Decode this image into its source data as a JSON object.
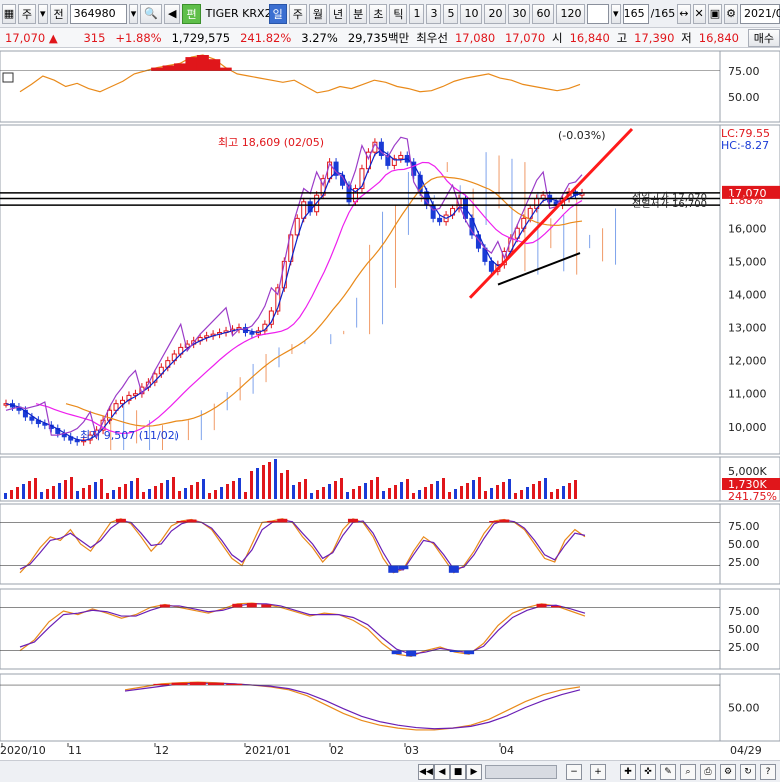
{
  "toolbar": {
    "menu_label": "주",
    "search_label": "전",
    "code": "364980",
    "name_tag": "편",
    "stock_name": "TIGER KRX2",
    "periods": [
      "일",
      "주",
      "월",
      "년",
      "분",
      "초",
      "틱"
    ],
    "selected_period": "일",
    "intervals": [
      "1",
      "3",
      "5",
      "10",
      "20",
      "30",
      "60",
      "120"
    ],
    "count_value": "165",
    "count_total": "/165",
    "date_value": "2021/0"
  },
  "quote": {
    "price": "17,070",
    "change": "315",
    "change_pct": "+1.88%",
    "volume": "1,729,575",
    "volume_ratio": "241.82%",
    "turnover": "3.27%",
    "amount": "29,735백만",
    "best_label": "최우선",
    "ask": "17,080",
    "bid": "17,070",
    "open_label": "시",
    "open": "16,840",
    "high_label": "고",
    "high": "17,390",
    "low_label": "저",
    "low": "16,840",
    "order_button": "매수"
  },
  "colors": {
    "up": "#e0161b",
    "down": "#1a3bd6",
    "ma5": "#0b22c9",
    "ma20": "#ee1fee",
    "kumo_up": "#f09a67",
    "kumo_down": "#7ea3ec"
  },
  "chart_data": [
    {
      "type": "line",
      "title": "",
      "y_ticks": [
        "75.00",
        "50.00"
      ],
      "ylim": [
        30,
        90
      ],
      "series": [
        {
          "values": [
            55,
            62,
            70,
            66,
            60,
            63,
            58,
            55,
            60,
            65,
            72,
            75,
            78,
            80,
            82,
            88,
            90,
            86,
            78,
            72,
            70,
            68,
            66,
            64,
            66,
            60,
            54,
            56,
            60,
            58,
            62,
            66,
            64,
            60,
            58,
            55,
            56,
            60,
            65,
            68,
            70,
            72,
            68,
            66,
            62,
            60,
            58,
            56,
            58,
            62
          ]
        }
      ]
    },
    {
      "type": "candlestick",
      "title": "",
      "annotations": {
        "high_label": "최고 18,609 (02/05)",
        "low_label": "최저 9,507 (11/02)",
        "change_label": "(-0.03%)",
        "lc": "LC:79.55",
        "hc": "HC:-8.27",
        "prev_high": "전일고가 17,070",
        "prev_low": "전일저가 16,700",
        "pct": "1.88%",
        "last": "17,070"
      },
      "y_ticks": [
        "16,000",
        "15,000",
        "14,000",
        "13,000",
        "12,000",
        "11,000",
        "10,000"
      ],
      "ylim": [
        9300,
        19000
      ],
      "x_ticks": [
        "2020/10",
        "11",
        "12",
        "2021/01",
        "02",
        "03",
        "04",
        "04/29"
      ],
      "close": [
        10700,
        10600,
        10500,
        10300,
        10200,
        10100,
        10050,
        9950,
        9800,
        9700,
        9600,
        9550,
        9600,
        9750,
        9900,
        10200,
        10500,
        10700,
        10800,
        10950,
        11000,
        11200,
        11350,
        11600,
        11800,
        12000,
        12200,
        12400,
        12500,
        12600,
        12700,
        12750,
        12800,
        12850,
        12900,
        12950,
        13000,
        12850,
        12800,
        12900,
        13100,
        13500,
        14200,
        15000,
        15800,
        16300,
        16800,
        16500,
        17000,
        17500,
        18000,
        17600,
        17300,
        16800,
        17200,
        17800,
        18300,
        18600,
        18200,
        17900,
        18100,
        18200,
        18000,
        17600,
        17100,
        16700,
        16300,
        16200,
        16400,
        16600,
        16900,
        16300,
        15800,
        15400,
        15000,
        14700,
        14900,
        15300,
        15700,
        16000,
        16300,
        16600,
        16900,
        17000,
        16800,
        16700,
        16900,
        17100,
        17000,
        17070
      ]
    },
    {
      "type": "bar",
      "title": "",
      "y_ticks": [
        "5,000K",
        "1,730K"
      ],
      "pct_label": "241.75%"
    },
    {
      "type": "line",
      "title": "",
      "y_ticks": [
        "75.00",
        "50.00",
        "25.00"
      ],
      "ylim": [
        0,
        100
      ],
      "series": [
        {
          "values": [
            10,
            25,
            45,
            60,
            55,
            70,
            50,
            40,
            60,
            80,
            85,
            78,
            60,
            40,
            55,
            75,
            82,
            84,
            80,
            70,
            50,
            30,
            20,
            50,
            80,
            82,
            85,
            80,
            60,
            45,
            25,
            40,
            70,
            85,
            80,
            60,
            30,
            10,
            15,
            40,
            60,
            50,
            30,
            10,
            20,
            40,
            65,
            82,
            84,
            80,
            70,
            50,
            30,
            25,
            55,
            70,
            60
          ]
        },
        {
          "values": [
            15,
            22,
            38,
            55,
            58,
            65,
            55,
            45,
            55,
            72,
            82,
            80,
            65,
            48,
            50,
            68,
            78,
            82,
            80,
            72,
            55,
            35,
            25,
            42,
            70,
            80,
            83,
            81,
            65,
            50,
            30,
            38,
            62,
            80,
            82,
            65,
            38,
            15,
            14,
            35,
            55,
            52,
            35,
            15,
            18,
            35,
            58,
            78,
            83,
            81,
            72,
            55,
            35,
            28,
            48,
            65,
            62
          ]
        }
      ]
    },
    {
      "type": "line",
      "title": "",
      "y_ticks": [
        "75.00",
        "50.00",
        "25.00"
      ],
      "ylim": [
        0,
        100
      ],
      "series": [
        {
          "values": [
            20,
            35,
            60,
            75,
            70,
            78,
            72,
            65,
            70,
            80,
            84,
            80,
            76,
            72,
            78,
            85,
            86,
            84,
            80,
            74,
            68,
            72,
            70,
            62,
            50,
            30,
            15,
            12,
            20,
            25,
            18,
            15,
            30,
            55,
            72,
            80,
            85,
            82,
            75,
            68
          ]
        },
        {
          "values": [
            25,
            32,
            52,
            70,
            72,
            76,
            74,
            68,
            68,
            76,
            82,
            82,
            78,
            74,
            76,
            82,
            85,
            85,
            82,
            76,
            70,
            70,
            70,
            66,
            56,
            38,
            22,
            15,
            18,
            23,
            20,
            17,
            26,
            48,
            66,
            76,
            82,
            83,
            78,
            72
          ]
        }
      ]
    },
    {
      "type": "line",
      "title": "",
      "y_ticks": [
        "50.00"
      ],
      "ylim": [
        0,
        100
      ],
      "series": [
        {
          "values": [
            80,
            85,
            90,
            92,
            93,
            92,
            90,
            88,
            85,
            80,
            70,
            55,
            40,
            28,
            20,
            15,
            12,
            12,
            15,
            20,
            30,
            45,
            60,
            72,
            80,
            85
          ]
        },
        {
          "values": [
            78,
            82,
            86,
            90,
            91,
            91,
            90,
            88,
            86,
            82,
            74,
            62,
            48,
            35,
            26,
            20,
            16,
            14,
            15,
            18,
            25,
            36,
            50,
            62,
            72,
            80
          ]
        }
      ]
    }
  ]
}
